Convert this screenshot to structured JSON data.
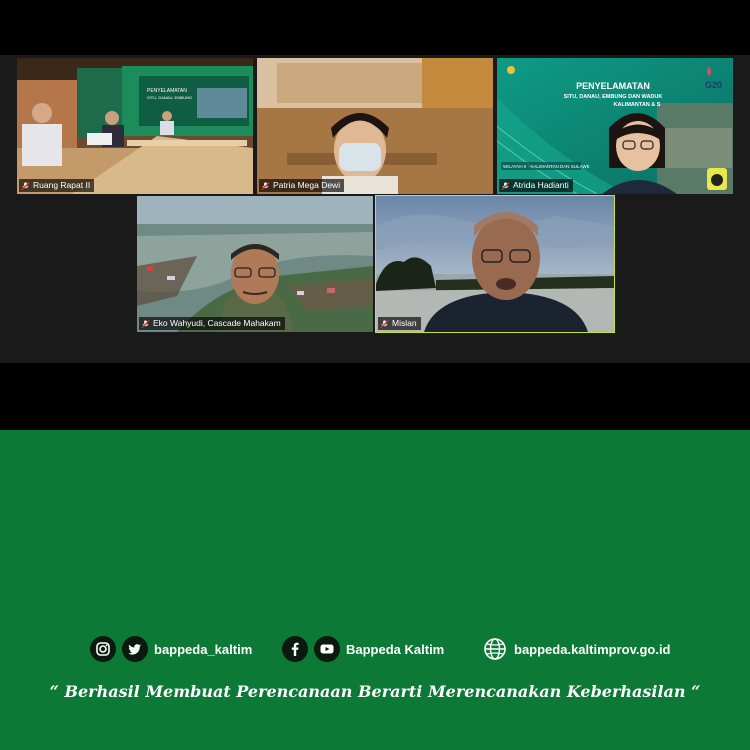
{
  "meeting": {
    "participants": [
      {
        "name": "Ruang Rapat II"
      },
      {
        "name": "Patria Mega Dewi"
      },
      {
        "name": "Atrida Hadianti"
      },
      {
        "name": "Eko Wahyudi, Cascade Mahakam"
      },
      {
        "name": "Mislan"
      }
    ],
    "background_slide": {
      "title": "PENYELAMATAN",
      "subtitle": "SITU, DANAU, EMBUNG DAN WADUK",
      "region": "KALIMANTAN & S",
      "badge": "G20",
      "lower_text": "WILAYAH II - KALIMANTAN DAN SULAWE"
    },
    "room_banner": {
      "title": "PENYELAMATAN",
      "subtitle": "SITU, DANAU, EMBUNG"
    },
    "active_speaker": "Mislan"
  },
  "footer": {
    "instagram_handle": "bappeda_kaltim",
    "facebook_handle": "Bappeda Kaltim",
    "website": "bappeda.kaltimprov.go.id",
    "tagline": "“ Berhasil  Membuat Perencanaan Berarti Merencanakan Keberhasilan “"
  },
  "colors": {
    "footer_bg": "#0c7a36",
    "active_border": "#c8e23a",
    "zoom_bg": "#1a1a1a"
  }
}
